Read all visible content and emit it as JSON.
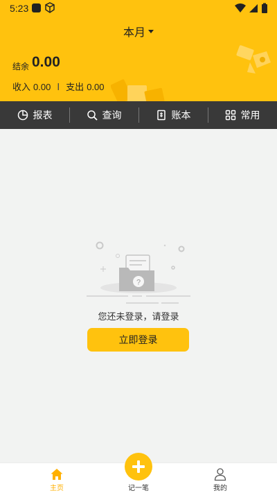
{
  "status_bar": {
    "time": "5:23"
  },
  "header": {
    "month_label": "本月",
    "balance_label": "结余",
    "balance_value": "0.00",
    "income_label": "收入",
    "income_value": "0.00",
    "separator": "I",
    "expense_label": "支出",
    "expense_value": "0.00"
  },
  "toolbar": {
    "items": [
      {
        "label": "报表",
        "icon": "pie-chart-icon"
      },
      {
        "label": "查询",
        "icon": "search-icon"
      },
      {
        "label": "账本",
        "icon": "ledger-icon"
      },
      {
        "label": "常用",
        "icon": "grid-icon"
      }
    ]
  },
  "empty_state": {
    "message": "您还未登录，请登录",
    "login_button": "立即登录"
  },
  "bottom_nav": {
    "home": "主页",
    "add": "记一笔",
    "mine": "我的"
  },
  "colors": {
    "accent": "#ffc20e",
    "toolbar_bg": "#393939",
    "page_bg": "#f2f3f2",
    "nav_active": "#ffb000"
  }
}
